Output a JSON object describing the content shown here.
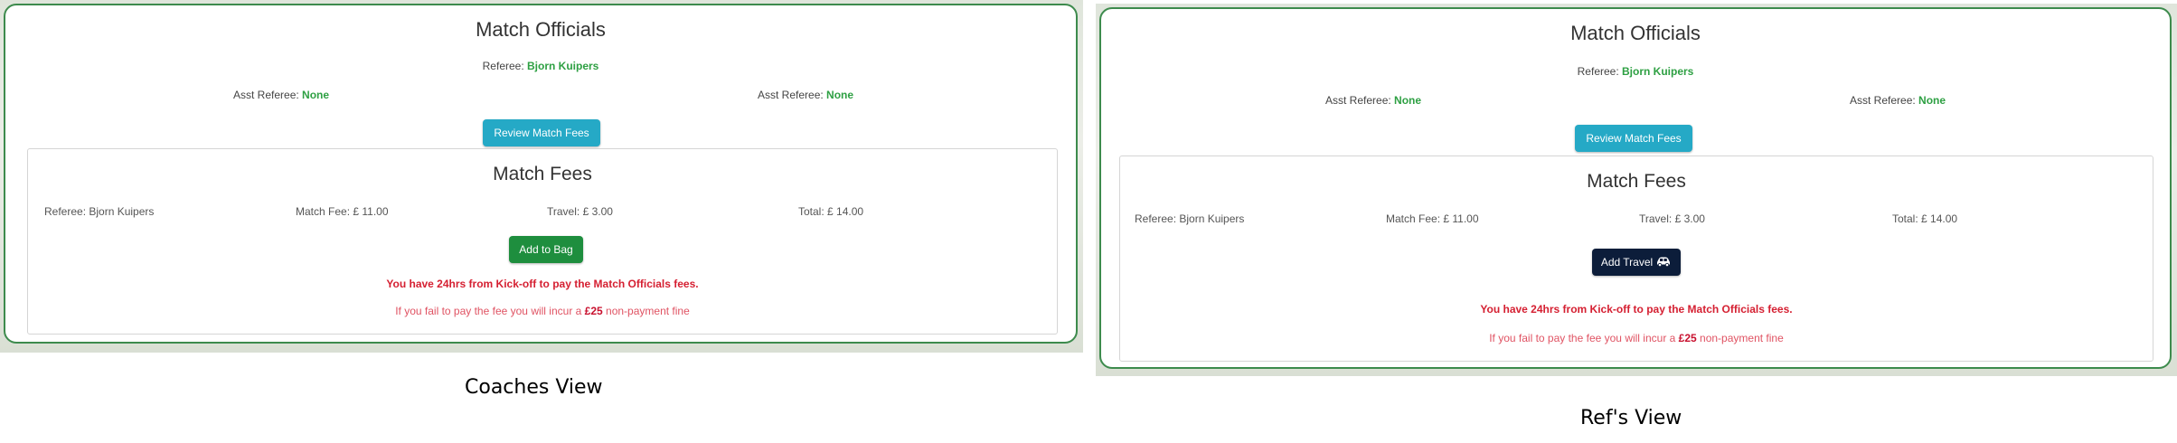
{
  "coach": {
    "section_title": "Match Officials",
    "referee_label": "Referee:",
    "referee_name": "Bjorn Kuipers",
    "asst1_label": "Asst Referee:",
    "asst1_value": "None",
    "asst2_label": "Asst Referee:",
    "asst2_value": "None",
    "review_button": "Review Match Fees",
    "fees_title": "Match Fees",
    "fee_referee": "Referee: Bjorn Kuipers",
    "fee_match": "Match Fee: £ 11.00",
    "fee_travel": "Travel: £ 3.00",
    "fee_total": "Total: £ 14.00",
    "action_button": "Add to Bag",
    "warning": "You have 24hrs from Kick-off to pay the Match Officials fees.",
    "fine_prefix": "If you fail to pay the fee you will incur a ",
    "fine_amount": "£25",
    "fine_suffix": " non-payment fine"
  },
  "ref": {
    "section_title": "Match Officials",
    "referee_label": "Referee:",
    "referee_name": "Bjorn Kuipers",
    "asst1_label": "Asst Referee:",
    "asst1_value": "None",
    "asst2_label": "Asst Referee:",
    "asst2_value": "None",
    "review_button": "Review Match Fees",
    "fees_title": "Match Fees",
    "fee_referee": "Referee: Bjorn Kuipers",
    "fee_match": "Match Fee: £ 11.00",
    "fee_travel": "Travel: £ 3.00",
    "fee_total": "Total: £ 14.00",
    "action_button": "Add Travel",
    "action_icon": "car-icon",
    "warning": "You have 24hrs from Kick-off to pay the Match Officials fees.",
    "fine_prefix": "If you fail to pay the fee you will incur a ",
    "fine_amount": "£25",
    "fine_suffix": " non-payment fine"
  },
  "captions": {
    "coach": "Coaches View",
    "ref": "Ref's View"
  },
  "colors": {
    "card_border": "#3d8b4d",
    "name_green": "#2ea043",
    "review_button": "#25a9c6",
    "bag_button": "#1e8e3e",
    "travel_button": "#0c1d3a",
    "warning_red": "#d52032"
  }
}
